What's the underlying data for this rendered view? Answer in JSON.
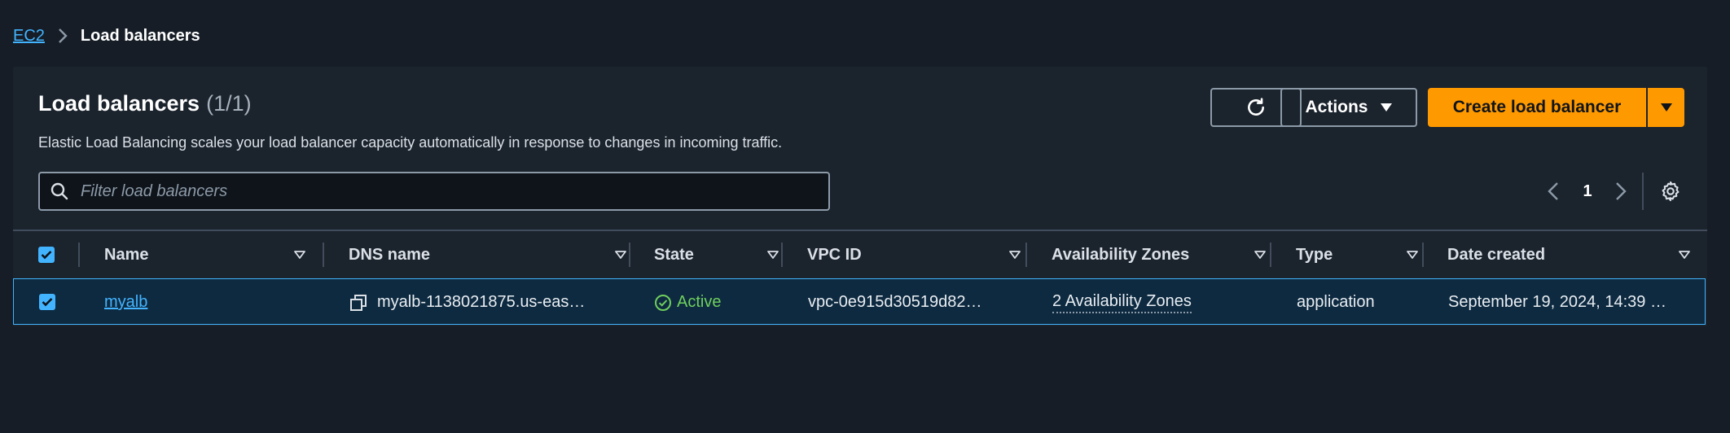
{
  "breadcrumb": {
    "parent": "EC2",
    "current": "Load balancers"
  },
  "panel": {
    "title": "Load balancers",
    "count": "(1/1)",
    "description": "Elastic Load Balancing scales your load balancer capacity automatically in response to changes in incoming traffic."
  },
  "toolbar": {
    "actions_label": "Actions",
    "create_label": "Create load balancer"
  },
  "search": {
    "placeholder": "Filter load balancers",
    "value": ""
  },
  "pagination": {
    "current_page": "1"
  },
  "table": {
    "columns": [
      "Name",
      "DNS name",
      "State",
      "VPC ID",
      "Availability Zones",
      "Type",
      "Date created"
    ],
    "rows": [
      {
        "name": "myalb",
        "dns_name": "myalb-1138021875.us-eas…",
        "state": "Active",
        "vpc_id": "vpc-0e915d30519d82…",
        "availability_zones": "2 Availability Zones",
        "type": "application",
        "date_created": "September 19, 2024, 14:39 …"
      }
    ]
  },
  "colors": {
    "background": "#161d26",
    "panel": "#1b232d",
    "accent_link": "#42b4ff",
    "primary_button": "#ff9900",
    "status_active": "#6fcf5d",
    "selected_row": "#0e2a40"
  },
  "icons": {
    "refresh": "refresh-icon",
    "actions_caret": "caret-down-icon",
    "search": "search-icon",
    "settings": "gear-icon",
    "copy": "copy-icon",
    "status": "check-circle-icon"
  }
}
